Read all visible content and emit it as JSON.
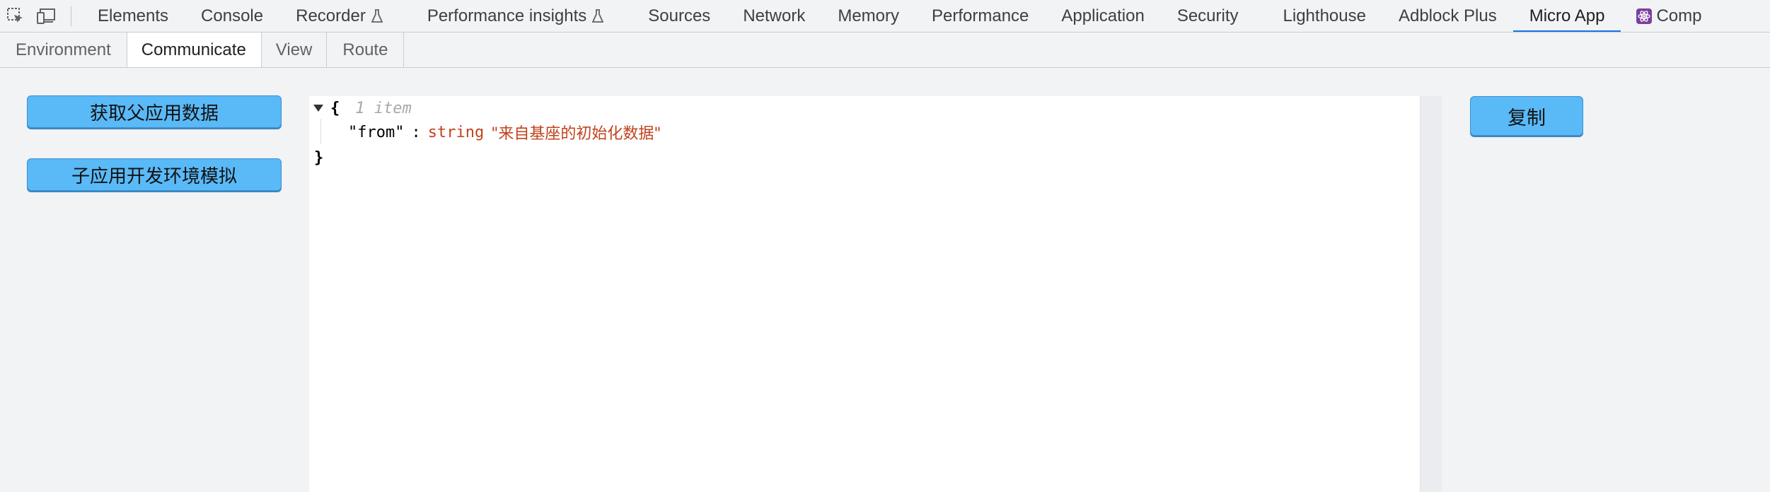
{
  "toolbar": {
    "inspect_icon": "inspect-element-icon",
    "device_icon": "device-toolbar-icon"
  },
  "main_tabs": [
    {
      "label": "Elements"
    },
    {
      "label": "Console"
    },
    {
      "label": "Recorder",
      "icon": "flask-icon"
    },
    {
      "label": "Performance insights",
      "icon": "flask-icon"
    },
    {
      "label": "Sources"
    },
    {
      "label": "Network"
    },
    {
      "label": "Memory"
    },
    {
      "label": "Performance"
    },
    {
      "label": "Application"
    },
    {
      "label": "Security"
    },
    {
      "label": "Lighthouse"
    },
    {
      "label": "Adblock Plus"
    },
    {
      "label": "Micro App",
      "active": true
    },
    {
      "label": "Comp",
      "icon": "react-icon"
    }
  ],
  "sub_tabs": [
    {
      "label": "Environment"
    },
    {
      "label": "Communicate",
      "active": true
    },
    {
      "label": "View"
    },
    {
      "label": "Route"
    }
  ],
  "actions": {
    "get_parent_data": "获取父应用数据",
    "simulate_dev_env": "子应用开发环境模拟",
    "copy": "复制"
  },
  "json_view": {
    "open_brace": "{",
    "item_count": "1 item",
    "key": "\"from\"",
    "colon": ":",
    "value_type": "string",
    "value": "\"来自基座的初始化数据\"",
    "close_brace": "}"
  },
  "colors": {
    "accent": "#1a73e8",
    "button": "#5ab9f7",
    "string_value": "#c1421c"
  }
}
